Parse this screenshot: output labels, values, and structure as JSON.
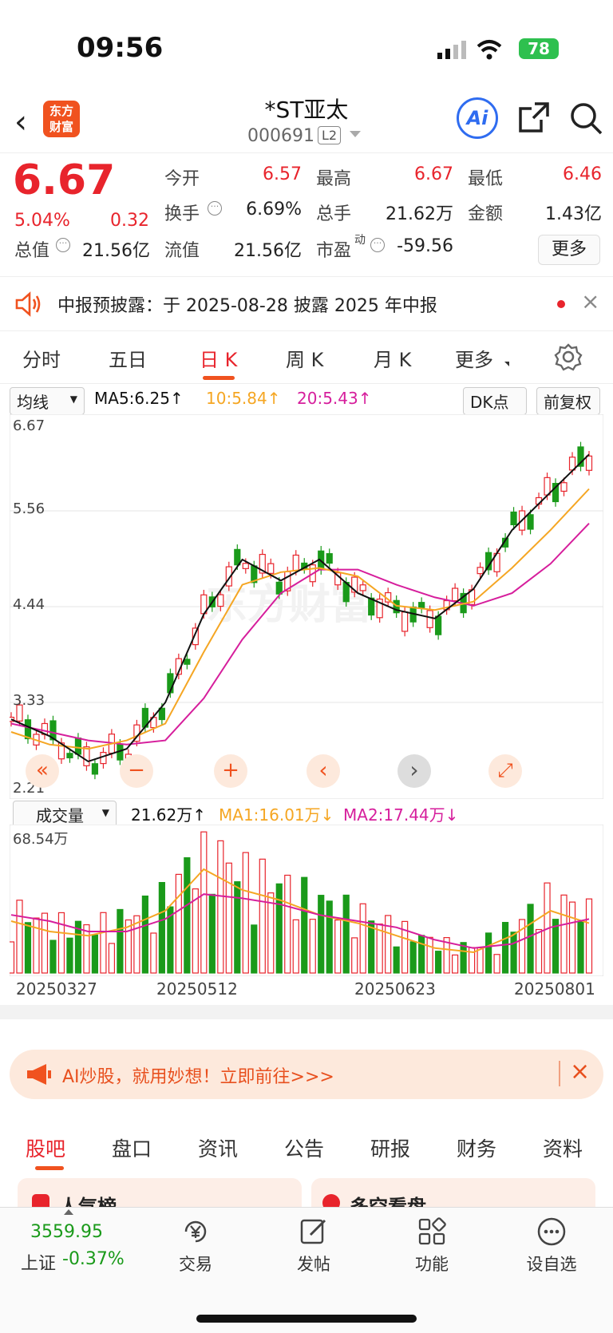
{
  "status_bar": {
    "time": "09:56",
    "battery": "78"
  },
  "header": {
    "logo_line1": "东方",
    "logo_line2": "财富",
    "stock_name": "*ST亚太",
    "stock_code": "000691",
    "level_badge": "L2",
    "ai_label": "Ai"
  },
  "quote": {
    "price": "6.67",
    "change_pct": "5.04%",
    "change": "0.32",
    "open_label": "今开",
    "open": "6.57",
    "high_label": "最高",
    "high": "6.67",
    "low_label": "最低",
    "low": "6.46",
    "turnover_label": "换手",
    "turnover": "6.69%",
    "volume_label": "总手",
    "volume": "21.62万",
    "amount_label": "金额",
    "amount": "1.43亿",
    "mktcap_label": "总值",
    "mktcap": "21.56亿",
    "float_label": "流值",
    "float_cap": "21.56亿",
    "pe_label": "市盈",
    "pe_sup": "动",
    "pe": "-59.56",
    "more_button": "更多"
  },
  "notice": {
    "text": "中报预披露：于 2025-08-28 披露 2025 年中报"
  },
  "tabs": [
    "分时",
    "五日",
    "日 K",
    "周 K",
    "月 K",
    "更多"
  ],
  "active_tab": 2,
  "kline_header": {
    "indicator": "均线",
    "ma5": "MA5:6.25",
    "ma10": "10:5.84",
    "ma20": "20:5.43",
    "dk_button": "DK点",
    "adjust_button": "前复权"
  },
  "price_axis": [
    "6.67",
    "5.56",
    "4.44",
    "3.33",
    "2.21"
  ],
  "chart_controls": [
    "«",
    "−",
    "+",
    "‹",
    "›",
    "⤢"
  ],
  "volume_header": {
    "indicator": "成交量",
    "vol": "21.62万",
    "ma1": "MA1:16.01万",
    "ma2": "MA2:17.44万"
  },
  "volume_axis_max": "68.54万",
  "date_labels": [
    "20250327",
    "20250512",
    "20250623",
    "20250801"
  ],
  "colors": {
    "up": "#e8242c",
    "down": "#1a9a1a",
    "ma5": "#111111",
    "ma10": "#f5a623",
    "ma20": "#d61e9c"
  },
  "chart_data": {
    "type": "candlestick",
    "x": [
      "20250327",
      "20250512",
      "20250623",
      "20250801"
    ],
    "ylim": [
      2.21,
      6.67
    ],
    "ma5": [
      3.1,
      2.9,
      2.6,
      2.75,
      3.3,
      4.35,
      5.0,
      4.75,
      5.0,
      4.6,
      4.4,
      4.3,
      4.65,
      5.35,
      5.8,
      6.25
    ],
    "ma10": [
      2.95,
      2.8,
      2.75,
      2.85,
      3.05,
      3.9,
      4.7,
      4.85,
      4.9,
      4.8,
      4.45,
      4.4,
      4.5,
      4.9,
      5.35,
      5.84
    ],
    "ma20": [
      3.05,
      2.95,
      2.85,
      2.8,
      2.85,
      3.35,
      4.05,
      4.6,
      4.88,
      4.88,
      4.7,
      4.55,
      4.45,
      4.6,
      4.95,
      5.43
    ],
    "volume_max": "68.54万",
    "volume_ma1": [
      25,
      20,
      18,
      22,
      30,
      50,
      40,
      35,
      28,
      24,
      18,
      12,
      10,
      18,
      30,
      24
    ],
    "volume_ma2": [
      28,
      25,
      20,
      20,
      26,
      38,
      36,
      33,
      28,
      25,
      22,
      16,
      12,
      14,
      22,
      26
    ]
  },
  "ad": {
    "text": "AI炒股，就用妙想！立即前往>>>"
  },
  "bottom_tabs": [
    "股吧",
    "盘口",
    "资讯",
    "公告",
    "研报",
    "财务",
    "资料"
  ],
  "peek_items": [
    "人气榜",
    "多空看盘"
  ],
  "toolbar": {
    "index_value": "3559.95",
    "index_name": "上证",
    "index_change": "-0.37%",
    "items": [
      "交易",
      "发帖",
      "功能",
      "设自选"
    ]
  }
}
